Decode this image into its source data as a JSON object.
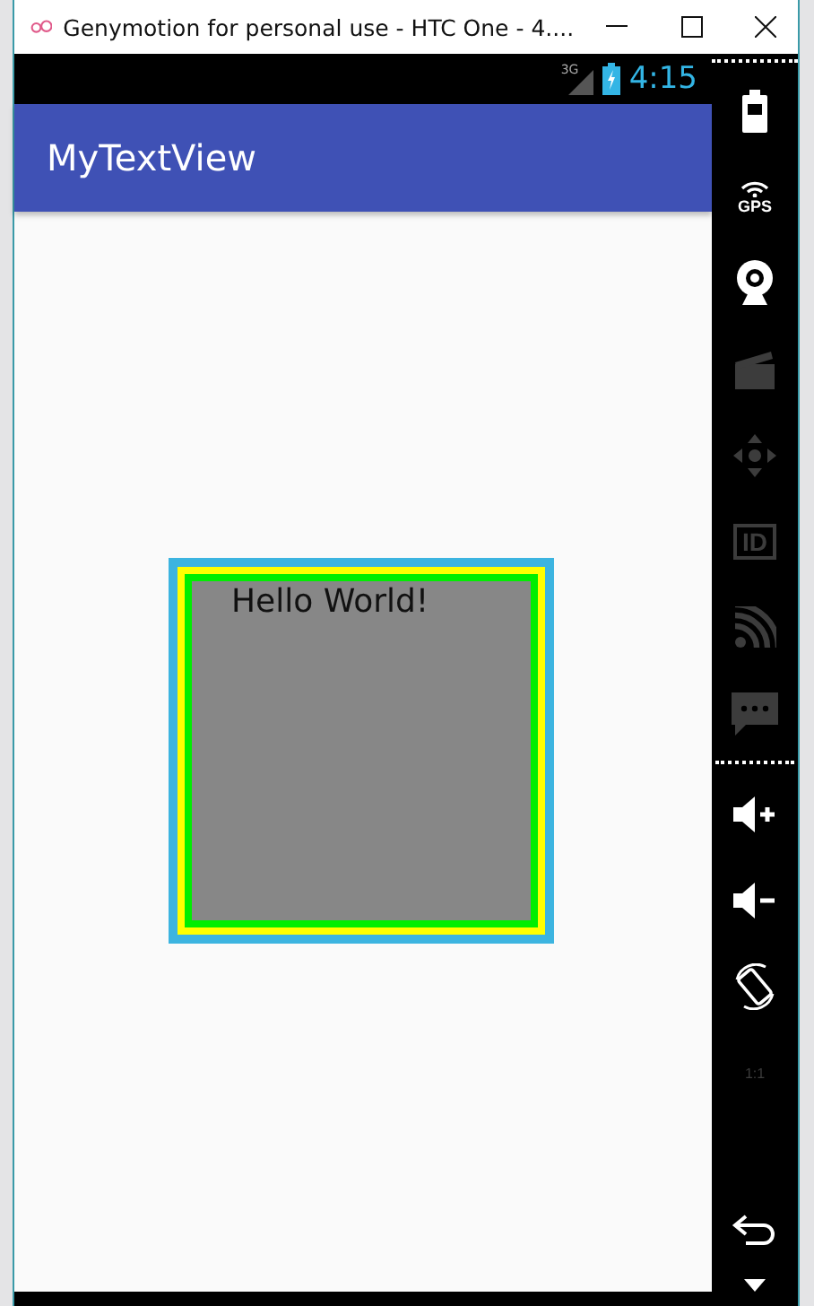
{
  "window": {
    "title": "Genymotion for personal use - HTC One - 4...."
  },
  "status_bar": {
    "network": "3G",
    "time": "4:15"
  },
  "app_bar": {
    "title": "MyTextView"
  },
  "text_view": {
    "text": "Hello World!"
  },
  "toolbar": {
    "items": [
      {
        "kind": "battery",
        "disabled": false
      },
      {
        "kind": "gps",
        "label": "GPS",
        "disabled": false
      },
      {
        "kind": "camera",
        "disabled": false
      },
      {
        "kind": "media",
        "disabled": true
      },
      {
        "kind": "dpad",
        "disabled": true
      },
      {
        "kind": "id",
        "label": "ID",
        "disabled": true
      },
      {
        "kind": "rss",
        "disabled": true
      },
      {
        "kind": "sms",
        "disabled": true
      },
      {
        "kind": "divider"
      },
      {
        "kind": "volume_up",
        "disabled": false
      },
      {
        "kind": "volume_down",
        "disabled": false
      },
      {
        "kind": "rotate",
        "disabled": false
      },
      {
        "kind": "scale",
        "label": "1:1",
        "disabled": true
      },
      {
        "kind": "back",
        "disabled": false
      },
      {
        "kind": "more",
        "disabled": false
      }
    ]
  }
}
